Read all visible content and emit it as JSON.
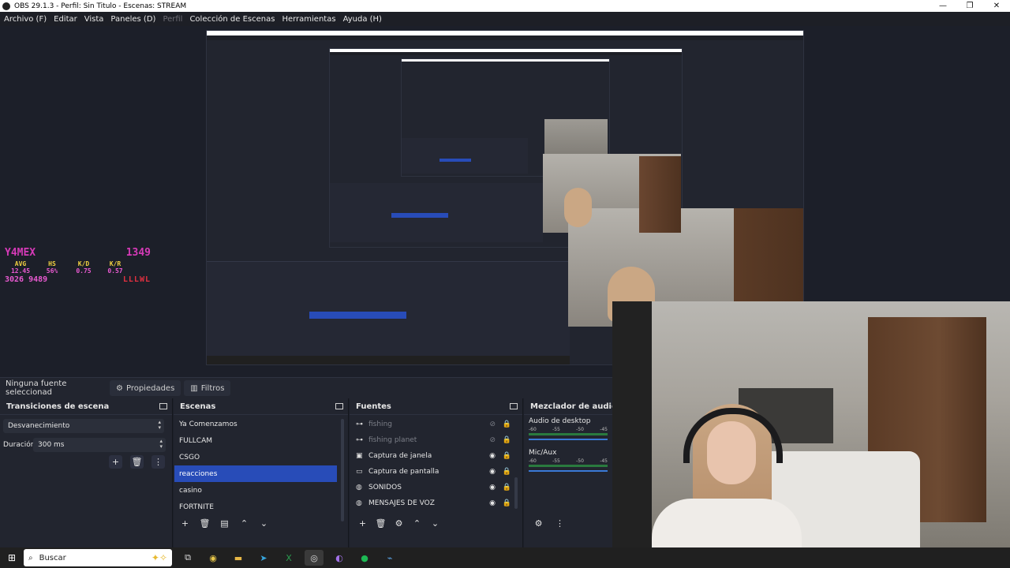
{
  "window": {
    "title": "OBS 29.1.3 - Perfil: Sin Titulo - Escenas: STREAM",
    "min": "—",
    "max": "❐",
    "close": "✕"
  },
  "menu": [
    "Archivo (F)",
    "Editar",
    "Vista",
    "Paneles (D)",
    "Perfil",
    "Colección de Escenas",
    "Herramientas",
    "Ayuda (H)"
  ],
  "overlay": {
    "name": "Y4MEX",
    "score": "1349",
    "labels": [
      "AVG",
      "HS",
      "K/D",
      "K/R"
    ],
    "values": [
      "12.45",
      "56%",
      "0.75",
      "0.57"
    ],
    "left1": "3026",
    "left2": "9489",
    "streak": "LLLWL"
  },
  "dock": {
    "no_source": "Ninguna fuente seleccionad",
    "properties": "Propiedades",
    "filters": "Filtros"
  },
  "transitions": {
    "title": "Transiciones de escena",
    "selected": "Desvanecimiento",
    "duration_label": "Duración",
    "duration_value": "300 ms"
  },
  "scenes": {
    "title": "Escenas",
    "items": [
      "Ya Comenzamos",
      "FULLCAM",
      "CSGO",
      "reacciones",
      "casino",
      "FORTNITE"
    ],
    "selected_index": 3
  },
  "sources": {
    "title": "Fuentes",
    "items": [
      {
        "label": "fishing",
        "icon": "link-icon",
        "hidden": true
      },
      {
        "label": "fishing planet",
        "icon": "link-icon",
        "hidden": true
      },
      {
        "label": "Captura de janela",
        "icon": "window-icon",
        "hidden": false
      },
      {
        "label": "Captura de pantalla",
        "icon": "monitor-icon",
        "hidden": false
      },
      {
        "label": "SONIDOS",
        "icon": "globe-icon",
        "hidden": false
      },
      {
        "label": "MENSAJES DE VOZ",
        "icon": "globe-icon",
        "hidden": false
      }
    ]
  },
  "mixer": {
    "title": "Mezclador de audio",
    "channels": [
      {
        "name": "Audio de desktop",
        "scale": [
          "-60",
          "-55",
          "-50",
          "-45"
        ]
      },
      {
        "name": "Mic/Aux",
        "scale": [
          "-60",
          "-55",
          "-50",
          "-45"
        ]
      }
    ]
  },
  "taskbar": {
    "search_placeholder": "Buscar"
  },
  "colors": {
    "accent": "#284cb8",
    "panel": "#22252f",
    "overlay_pink": "#d63ab8"
  }
}
